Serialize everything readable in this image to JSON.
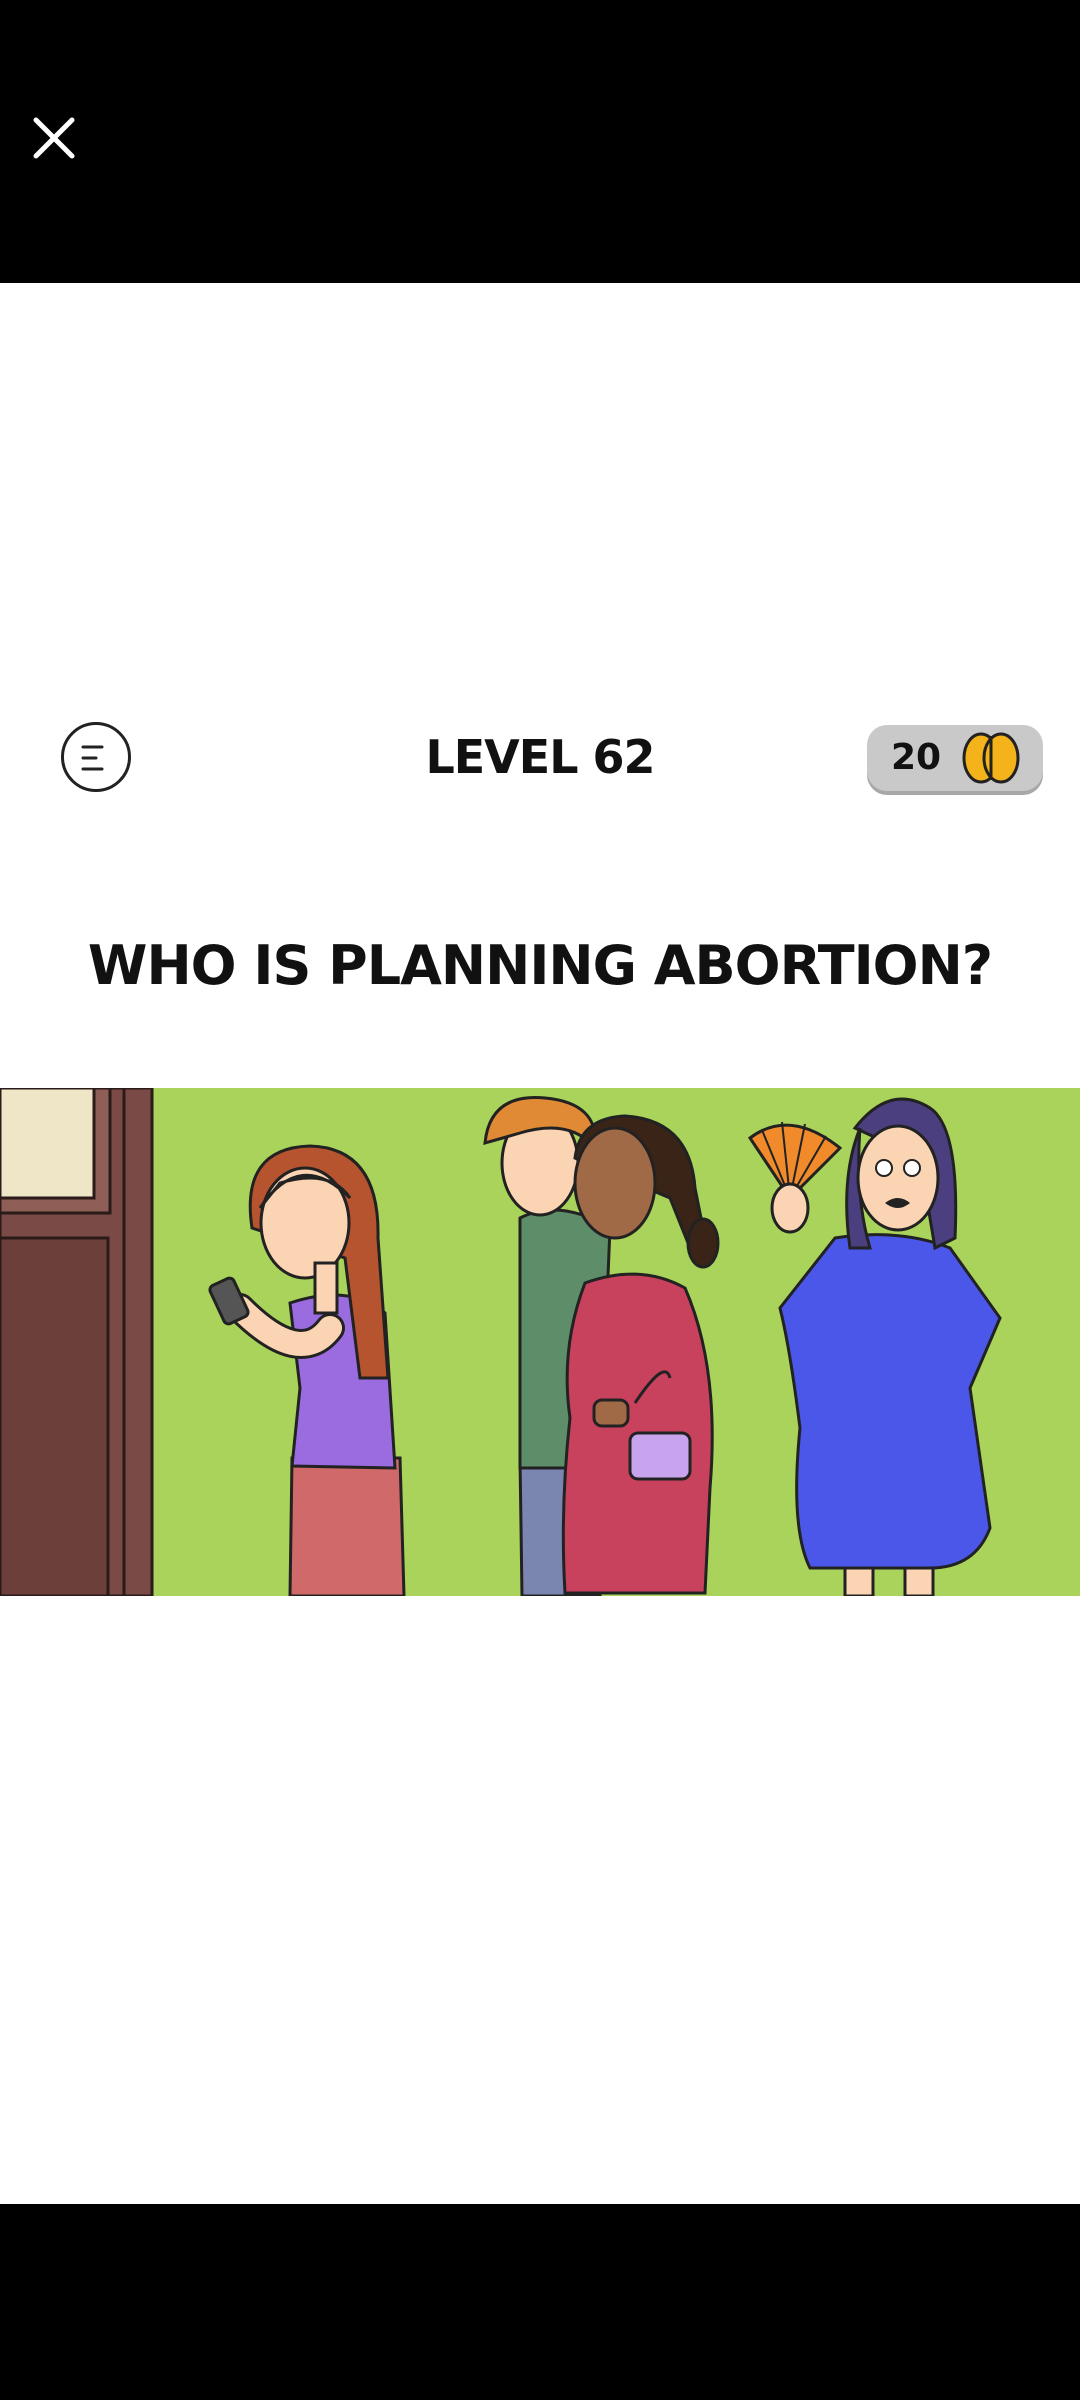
{
  "header": {
    "close_icon": "close-icon",
    "menu_icon": "menu-lines-icon",
    "level_label": "LEVEL 62",
    "hint_count": "20",
    "hint_icon": "brain-icon"
  },
  "question": {
    "text": "WHO IS PLANNING ABORTION?"
  },
  "scene": {
    "characters": [
      "woman-with-phone",
      "man-in-green-shirt",
      "pregnant-woman-with-purse",
      "pregnant-woman-with-fan"
    ],
    "colors": {
      "background": "#a9d35a",
      "door": "#7a4b46",
      "fan": "#f08a2a",
      "blue_dress": "#4a57e8",
      "red_dress": "#c8415d",
      "purple_shirt": "#9b6be0"
    }
  }
}
